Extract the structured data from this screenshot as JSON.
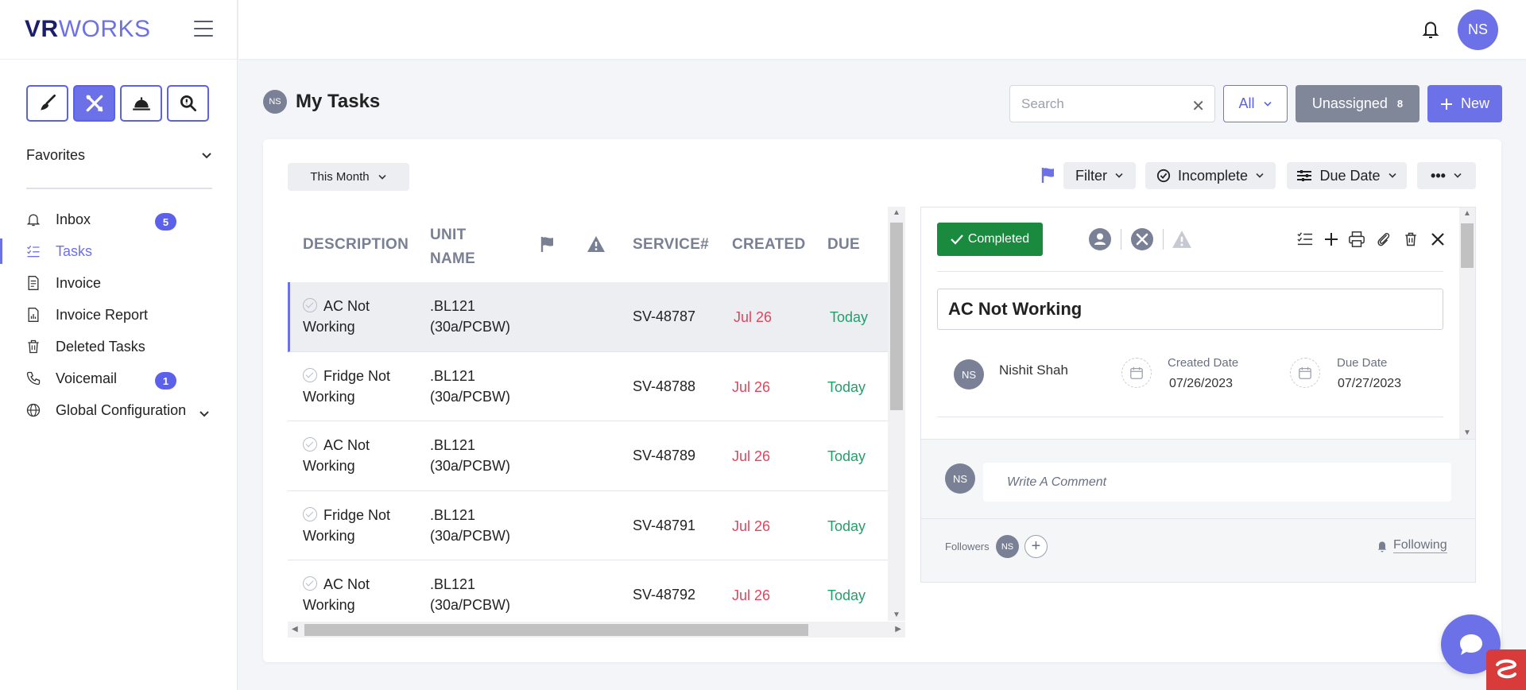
{
  "app": {
    "logo_bold": "VR",
    "logo_light": "WORKS"
  },
  "user": {
    "initials": "NS"
  },
  "sidebar": {
    "favorites_label": "Favorites",
    "items": [
      {
        "label": "Inbox",
        "icon": "bell-icon",
        "badge": "5"
      },
      {
        "label": "Tasks",
        "icon": "checklist-icon",
        "active": true
      },
      {
        "label": "Invoice",
        "icon": "invoice-icon"
      },
      {
        "label": "Invoice Report",
        "icon": "report-icon"
      },
      {
        "label": "Deleted Tasks",
        "icon": "trash-icon"
      },
      {
        "label": "Voicemail",
        "icon": "phone-icon",
        "badge": "1"
      },
      {
        "label": "Global Configuration",
        "icon": "globe-icon",
        "expandable": true
      }
    ]
  },
  "header": {
    "title": "My Tasks",
    "search_placeholder": "Search",
    "all_label": "All",
    "unassigned_label": "Unassigned",
    "unassigned_count": "8",
    "new_label": "New"
  },
  "toolbar": {
    "period_label": "This Month",
    "filter_label": "Filter",
    "status_label": "Incomplete",
    "sort_label": "Due Date",
    "more_label": "•••"
  },
  "table": {
    "columns": [
      "DESCRIPTION",
      "UNIT NAME",
      "SERVICE#",
      "CREATED",
      "DUE"
    ],
    "unit_name_lines": [
      "UNIT",
      "NAME"
    ],
    "rows": [
      {
        "desc1": "AC Not",
        "desc2": "Working",
        "unit1": ".BL121",
        "unit2": "(30a/PCBW)",
        "service": "SV-48787",
        "created": "Jul 26",
        "due": "Today",
        "selected": true
      },
      {
        "desc1": "Fridge Not",
        "desc2": "Working",
        "unit1": ".BL121",
        "unit2": "(30a/PCBW)",
        "service": "SV-48788",
        "created": "Jul 26",
        "due": "Today"
      },
      {
        "desc1": "AC Not",
        "desc2": "Working",
        "unit1": ".BL121",
        "unit2": "(30a/PCBW)",
        "service": "SV-48789",
        "created": "Jul 26",
        "due": "Today"
      },
      {
        "desc1": "Fridge Not",
        "desc2": "Working",
        "unit1": ".BL121",
        "unit2": "(30a/PCBW)",
        "service": "SV-48791",
        "created": "Jul 26",
        "due": "Today"
      },
      {
        "desc1": "AC Not",
        "desc2": "Working",
        "unit1": ".BL121",
        "unit2": "(30a/PCBW)",
        "service": "SV-48792",
        "created": "Jul 26",
        "due": "Today"
      }
    ]
  },
  "detail": {
    "completed_label": "Completed",
    "task_title": "AC Not Working",
    "assignee_name": "Nishit Shah",
    "created_date_label": "Created Date",
    "created_date": "07/26/2023",
    "due_date_label": "Due Date",
    "due_date": "07/27/2023",
    "comment_placeholder": "Write A Comment",
    "followers_label": "Followers",
    "following_label": "Following"
  },
  "colors": {
    "accent": "#6c71e8",
    "completed": "#1a8a3e",
    "created_red": "#e2445c",
    "due_green": "#22a06b"
  }
}
